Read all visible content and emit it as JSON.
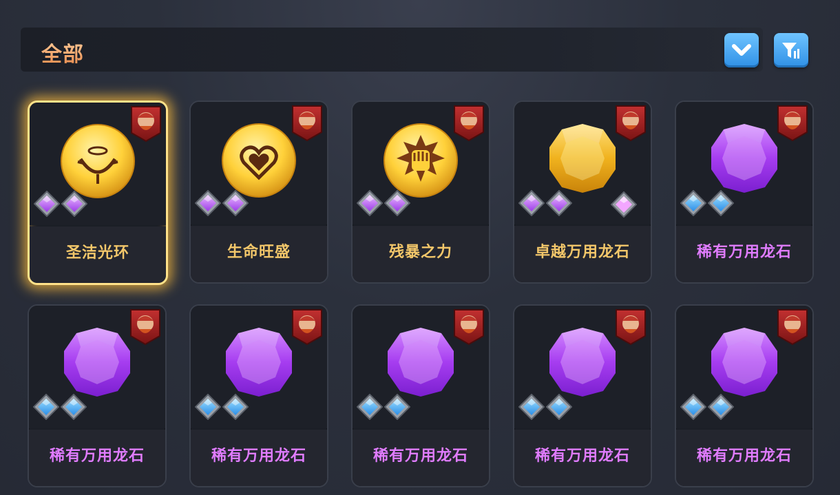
{
  "header": {
    "title": "全部"
  },
  "buttons": {
    "dropdown_icon": "chevron-down-icon",
    "filter_icon": "filter-sort-icon"
  },
  "colors": {
    "gold_text": "#f3c76a",
    "purple_text": "#e07cff",
    "accent_blue": "#3a9ff0",
    "selected_glow": "#ffcc4d"
  },
  "items": [
    {
      "name": "圣洁光环",
      "icon": "halo-medallion-icon",
      "hero": "viking-hero-portrait",
      "slots": "purple",
      "selected": true
    },
    {
      "name": "生命旺盛",
      "icon": "heart-medallion-icon",
      "hero": "redhair-hero-portrait",
      "slots": "purple",
      "selected": false
    },
    {
      "name": "残暴之力",
      "icon": "fist-medallion-icon",
      "hero": "blonde-hero-portrait",
      "slots": "purple",
      "selected": false
    },
    {
      "name": "卓越万用龙石",
      "icon": "gold-dragonstone-icon",
      "hero": "redhair-hero-portrait",
      "slots": "purple",
      "selected": false
    },
    {
      "name": "稀有万用龙石",
      "icon": "purple-dragonstone-icon",
      "hero": "redhair-hero-portrait",
      "slots": "blue",
      "selected": false
    },
    {
      "name": "稀有万用龙石",
      "icon": "purple-dragonstone-icon",
      "hero": "darkelf-hero-portrait",
      "slots": "blue",
      "selected": false
    },
    {
      "name": "稀有万用龙石",
      "icon": "purple-dragonstone-icon",
      "hero": "viking-hero-portrait",
      "slots": "blue",
      "selected": false
    },
    {
      "name": "稀有万用龙石",
      "icon": "purple-dragonstone-icon",
      "hero": "knight-hero-portrait",
      "slots": "blue",
      "selected": false
    },
    {
      "name": "稀有万用龙石",
      "icon": "purple-dragonstone-icon",
      "hero": "knight-hero-portrait",
      "slots": "blue",
      "selected": false
    },
    {
      "name": "稀有万用龙石",
      "icon": "purple-dragonstone-icon",
      "hero": "knight-hero-portrait",
      "slots": "blue",
      "selected": false
    }
  ]
}
